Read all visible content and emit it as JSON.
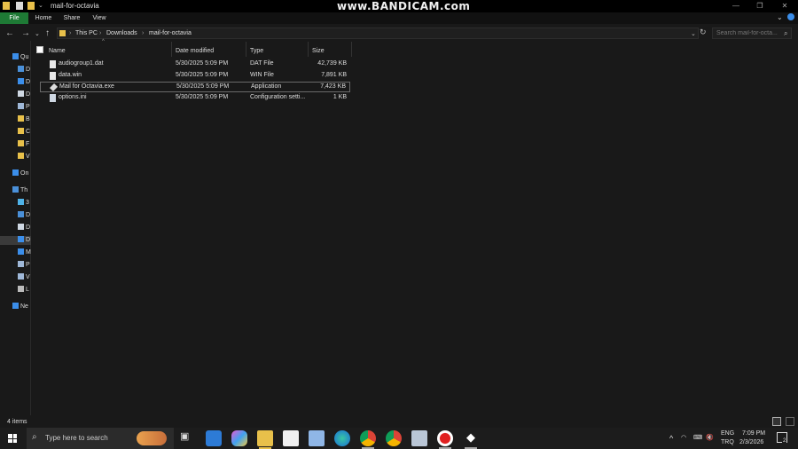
{
  "window": {
    "title": "mail-for-octavia",
    "watermark": "www.BANDICAM.com",
    "controls": [
      "—",
      "❐",
      "✕"
    ]
  },
  "ribbon": {
    "tabs": [
      "File",
      "Home",
      "Share",
      "View"
    ]
  },
  "address": {
    "crumbs": [
      "This PC",
      "Downloads",
      "mail-for-octavia"
    ],
    "search_placeholder": "Search mail-for-octa..."
  },
  "nav": {
    "items": [
      {
        "label": "Qu",
        "icon": "star-icon",
        "color": "#3b8eea"
      },
      {
        "label": "D",
        "icon": "desktop-icon",
        "color": "#4a90d9"
      },
      {
        "label": "D",
        "icon": "download-icon",
        "color": "#3b8eea"
      },
      {
        "label": "D",
        "icon": "document-icon",
        "color": "#cfd8e3"
      },
      {
        "label": "P",
        "icon": "picture-icon",
        "color": "#9fb8d8"
      },
      {
        "label": "B",
        "icon": "folder-icon",
        "color": "#e8c04a"
      },
      {
        "label": "C",
        "icon": "folder-icon",
        "color": "#e8c04a"
      },
      {
        "label": "F",
        "icon": "folder-icon",
        "color": "#e8c04a"
      },
      {
        "label": "V",
        "icon": "folder-icon",
        "color": "#e8c04a"
      },
      {
        "label": "On",
        "icon": "cloud-icon",
        "color": "#3b8eea"
      },
      {
        "label": "Th",
        "icon": "pc-icon",
        "color": "#4a90d9"
      },
      {
        "label": "3",
        "icon": "cube-icon",
        "color": "#4fb3e8"
      },
      {
        "label": "D",
        "icon": "desktop-icon",
        "color": "#4a90d9"
      },
      {
        "label": "D",
        "icon": "document-icon",
        "color": "#cfd8e3"
      },
      {
        "label": "D",
        "icon": "download-icon",
        "color": "#3b8eea"
      },
      {
        "label": "M",
        "icon": "music-icon",
        "color": "#3b8eea"
      },
      {
        "label": "P",
        "icon": "picture-icon",
        "color": "#9fb8d8"
      },
      {
        "label": "V",
        "icon": "video-icon",
        "color": "#9fb8d8"
      },
      {
        "label": "L",
        "icon": "drive-icon",
        "color": "#bbbbbb"
      },
      {
        "label": "Ne",
        "icon": "network-icon",
        "color": "#3b8eea"
      }
    ]
  },
  "columns": [
    "Name",
    "Date modified",
    "Type",
    "Size"
  ],
  "files": [
    {
      "name": "audiogroup1.dat",
      "date": "5/30/2025 5:09 PM",
      "type": "DAT File",
      "size": "42,739 KB",
      "icon": "file-icon"
    },
    {
      "name": "data.win",
      "date": "5/30/2025 5:09 PM",
      "type": "WIN File",
      "size": "7,891 KB",
      "icon": "file-icon"
    },
    {
      "name": "Mail for Octavia.exe",
      "date": "5/30/2025 5:09 PM",
      "type": "Application",
      "size": "7,423 KB",
      "icon": "app-icon"
    },
    {
      "name": "options.ini",
      "date": "5/30/2025 5:09 PM",
      "type": "Configuration setti...",
      "size": "1 KB",
      "icon": "settings-file-icon"
    }
  ],
  "status": {
    "item_count": "4 items"
  },
  "taskbar": {
    "search_placeholder": "Type here to search",
    "language": "ENG",
    "region": "TRQ",
    "time": "7:09 PM",
    "date": "2/3/2026",
    "notification_count": "2"
  }
}
